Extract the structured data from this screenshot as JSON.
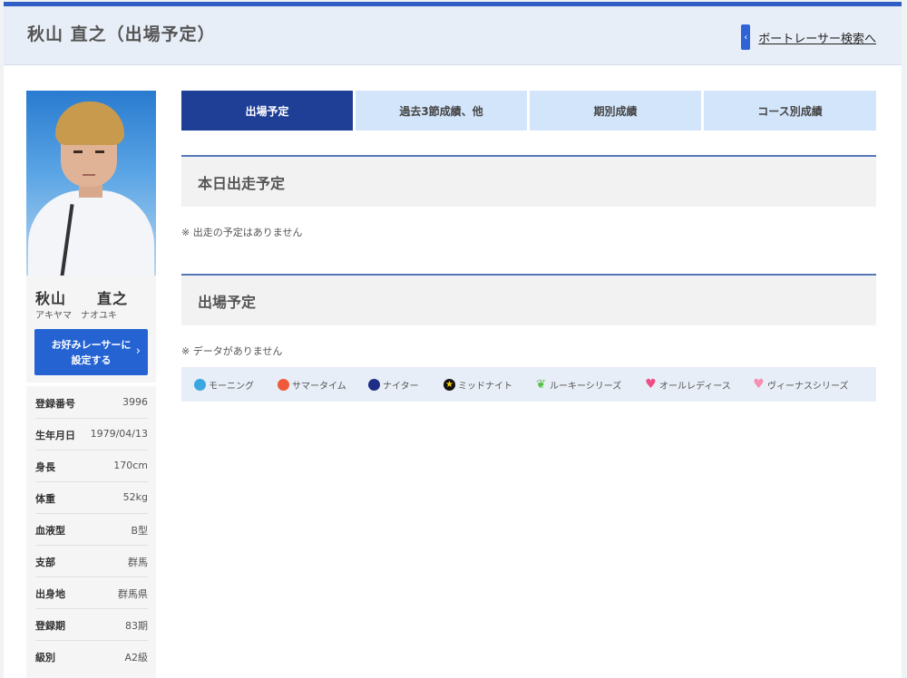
{
  "header": {
    "title": "秋山 直之（出場予定）",
    "search_link": "ボートレーサー検索へ"
  },
  "racer": {
    "name": "秋山　　直之",
    "kana": "アキヤマ　ナオユキ",
    "favorite_button": "お好みレーサーに\n設定する"
  },
  "profile": [
    {
      "label": "登録番号",
      "value": "3996"
    },
    {
      "label": "生年月日",
      "value": "1979/04/13"
    },
    {
      "label": "身長",
      "value": "170cm"
    },
    {
      "label": "体重",
      "value": "52kg"
    },
    {
      "label": "血液型",
      "value": "B型"
    },
    {
      "label": "支部",
      "value": "群馬"
    },
    {
      "label": "出身地",
      "value": "群馬県"
    },
    {
      "label": "登録期",
      "value": "83期"
    },
    {
      "label": "級別",
      "value": "A2級"
    }
  ],
  "tabs": [
    {
      "label": "出場予定",
      "active": true
    },
    {
      "label": "過去3節成績、他",
      "active": false
    },
    {
      "label": "期別成績",
      "active": false
    },
    {
      "label": "コース別成績",
      "active": false
    }
  ],
  "today": {
    "heading": "本日出走予定",
    "note": "※ 出走の予定はありません"
  },
  "schedule": {
    "heading": "出場予定",
    "note": "※ データがありません"
  },
  "legend": [
    {
      "icon": "morning-icon",
      "label": "モーニング"
    },
    {
      "icon": "summer-time-icon",
      "label": "サマータイム"
    },
    {
      "icon": "nighter-icon",
      "label": "ナイター"
    },
    {
      "icon": "midnight-icon",
      "label": "ミッドナイト"
    },
    {
      "icon": "rookie-icon",
      "label": "ルーキーシリーズ"
    },
    {
      "icon": "ladies-icon",
      "label": "オールレディース"
    },
    {
      "icon": "venus-icon",
      "label": "ヴィーナスシリーズ"
    }
  ],
  "colors": {
    "accent": "#2f63d6",
    "active_tab": "#1f3e96",
    "tab": "#d3e5fa",
    "section_border": "#5577b7"
  }
}
